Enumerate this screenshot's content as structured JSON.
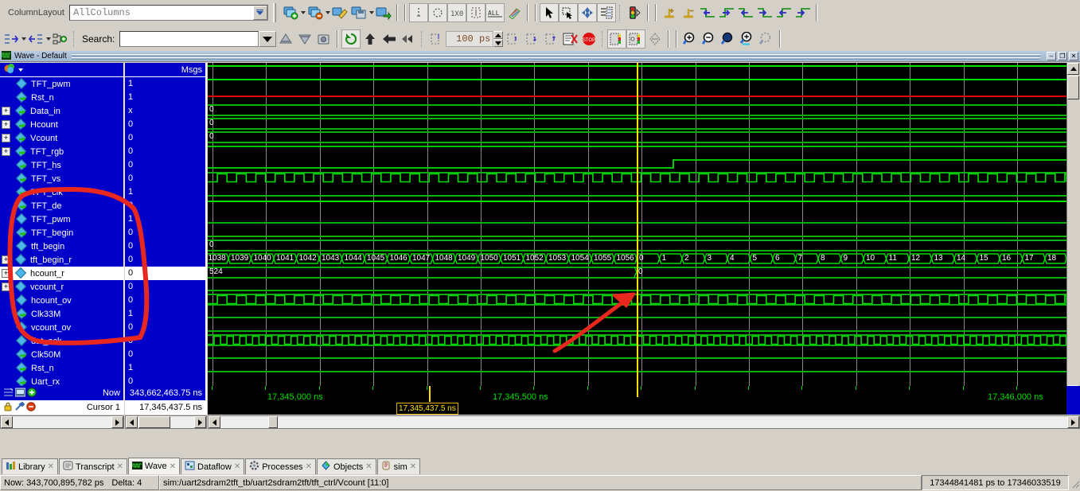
{
  "toolbar": {
    "column_layout_label": "ColumnLayout",
    "column_layout_value": "AllColumns",
    "search_label": "Search:",
    "search_value": "",
    "search_placeholder": "",
    "zoom_step_value": "100 ps",
    "icons_row1": [
      "add-wave-icon",
      "add-wave-dropdown",
      "remove-wave-icon",
      "remove-wave-dropdown",
      "edit-wave-icon",
      "save-wave-icon",
      "save-wave-dropdown",
      "open-wave-icon",
      "cursor-info-icon",
      "circle-icon",
      "radix-icon",
      "select-region-icon",
      "all-icon",
      "color-icon",
      "select-mode-icon",
      "zoom-mode-icon",
      "pan-mode-icon",
      "properties-icon",
      "traffic-light-icon",
      "insert-cursor-icon",
      "delete-cursor-icon",
      "prev-transition-icon",
      "next-transition-icon",
      "prev-falling-icon",
      "next-falling-icon",
      "prev-rising-icon",
      "next-rising-icon"
    ],
    "icons_row2": [
      "restart-icon",
      "run-all-icon",
      "run-back-icon",
      "continue-icon",
      "step-icon",
      "step-over-icon",
      "step-out-icon",
      "break-icon",
      "stop-icon",
      "wave-compare-icon",
      "wave-compare2-icon",
      "wave-compare3-icon",
      "wave-merge-icon",
      "zoom-in-icon",
      "zoom-out-icon",
      "zoom-full-icon",
      "zoom-cursor-icon",
      "zoom-range-icon"
    ]
  },
  "wave_window": {
    "title": "Wave - Default",
    "minimize_label": "–",
    "restore_label": "❐",
    "close_label": "✕"
  },
  "columns": {
    "name_header": "",
    "msgs_header": "Msgs"
  },
  "signals": [
    {
      "name": "TFT_pwm",
      "value": "1",
      "expandable": false,
      "kind": "internal",
      "selected": false
    },
    {
      "name": "Rst_n",
      "value": "1",
      "expandable": false,
      "kind": "input",
      "selected": false
    },
    {
      "name": "Data_in",
      "value": "x",
      "expandable": true,
      "kind": "input",
      "selected": false
    },
    {
      "name": "Hcount",
      "value": "0",
      "expandable": true,
      "kind": "output",
      "selected": false
    },
    {
      "name": "Vcount",
      "value": "0",
      "expandable": true,
      "kind": "output",
      "selected": false
    },
    {
      "name": "TFT_rgb",
      "value": "0",
      "expandable": true,
      "kind": "output",
      "selected": false
    },
    {
      "name": "TFT_hs",
      "value": "0",
      "expandable": false,
      "kind": "output",
      "selected": false
    },
    {
      "name": "TFT_vs",
      "value": "0",
      "expandable": false,
      "kind": "output",
      "selected": false
    },
    {
      "name": "TFT_clk",
      "value": "1",
      "expandable": false,
      "kind": "output",
      "selected": false
    },
    {
      "name": "TFT_de",
      "value": "0",
      "expandable": false,
      "kind": "output",
      "selected": false
    },
    {
      "name": "TFT_pwm",
      "value": "1",
      "expandable": false,
      "kind": "internal",
      "selected": false
    },
    {
      "name": "TFT_begin",
      "value": "0",
      "expandable": false,
      "kind": "output",
      "selected": false
    },
    {
      "name": "tft_begin",
      "value": "0",
      "expandable": false,
      "kind": "internal",
      "selected": false
    },
    {
      "name": "tft_begin_r",
      "value": "0",
      "expandable": true,
      "kind": "internal",
      "selected": false
    },
    {
      "name": "hcount_r",
      "value": "0",
      "expandable": true,
      "kind": "internal",
      "selected": true
    },
    {
      "name": "vcount_r",
      "value": "0",
      "expandable": true,
      "kind": "internal",
      "selected": false
    },
    {
      "name": "hcount_ov",
      "value": "0",
      "expandable": false,
      "kind": "internal",
      "selected": false
    },
    {
      "name": "Clk33M",
      "value": "1",
      "expandable": false,
      "kind": "input",
      "selected": false
    },
    {
      "name": "vcount_ov",
      "value": "0",
      "expandable": false,
      "kind": "internal",
      "selected": false
    },
    {
      "name": "dat_ack",
      "value": "0",
      "expandable": false,
      "kind": "internal",
      "selected": false
    },
    {
      "name": "Clk50M",
      "value": "0",
      "expandable": false,
      "kind": "input",
      "selected": false
    },
    {
      "name": "Rst_n",
      "value": "1",
      "expandable": false,
      "kind": "input",
      "selected": false
    },
    {
      "name": "Uart_rx",
      "value": "0",
      "expandable": false,
      "kind": "input",
      "selected": false
    }
  ],
  "waveform": {
    "hcount_r_before_cursor": [
      "1038",
      "1039",
      "1040",
      "1041",
      "1042",
      "1043",
      "1044",
      "1045",
      "1046",
      "1047",
      "1048",
      "1049",
      "1050",
      "1051",
      "1052",
      "1053",
      "1054",
      "1055",
      "1056"
    ],
    "hcount_r_after_cursor": [
      "0",
      "1",
      "2",
      "3",
      "4",
      "5",
      "6",
      "7",
      "8",
      "9",
      "10",
      "11",
      "12",
      "13",
      "14",
      "15",
      "16",
      "17",
      "18"
    ],
    "vcount_r_before_cursor": "524",
    "vcount_r_after_cursor": "0",
    "bus_zero_rows": [
      "0",
      "0",
      "0"
    ],
    "hcount_bus_value": "0",
    "vcount_bus_value": "0",
    "tft_rgb_bus_value": "0",
    "tft_begin_r_bus_value": "0"
  },
  "time_axis": {
    "labels": [
      "17,345,000 ns",
      "17,345,500 ns",
      "17,346,000 ns"
    ],
    "cursor_badge": "17,345,437.5 ns"
  },
  "footer": {
    "now_label": "Now",
    "now_value": "343,662,463.75 ns",
    "cursor_label": "Cursor 1",
    "cursor_value": "17,345,437.5 ns"
  },
  "tabs": [
    {
      "label": "Library",
      "icon": "library-icon",
      "active": false
    },
    {
      "label": "Transcript",
      "icon": "transcript-icon",
      "active": false
    },
    {
      "label": "Wave",
      "icon": "wave-icon",
      "active": true
    },
    {
      "label": "Dataflow",
      "icon": "dataflow-icon",
      "active": false
    },
    {
      "label": "Processes",
      "icon": "processes-icon",
      "active": false
    },
    {
      "label": "Objects",
      "icon": "objects-icon",
      "active": false
    },
    {
      "label": "sim",
      "icon": "sim-icon",
      "active": false
    }
  ],
  "status_bar": {
    "now": "Now: 343,700,895,782 ps",
    "delta": "Delta: 4",
    "path": "sim:/uart2sdram2tft_tb/uart2sdram2tft/tft_ctrl/Vcount [11:0]",
    "range": "17344841481 ps to 17346033519"
  },
  "annotations": {
    "ellipse_color": "#e8281e",
    "arrow_color": "#e8281e"
  }
}
